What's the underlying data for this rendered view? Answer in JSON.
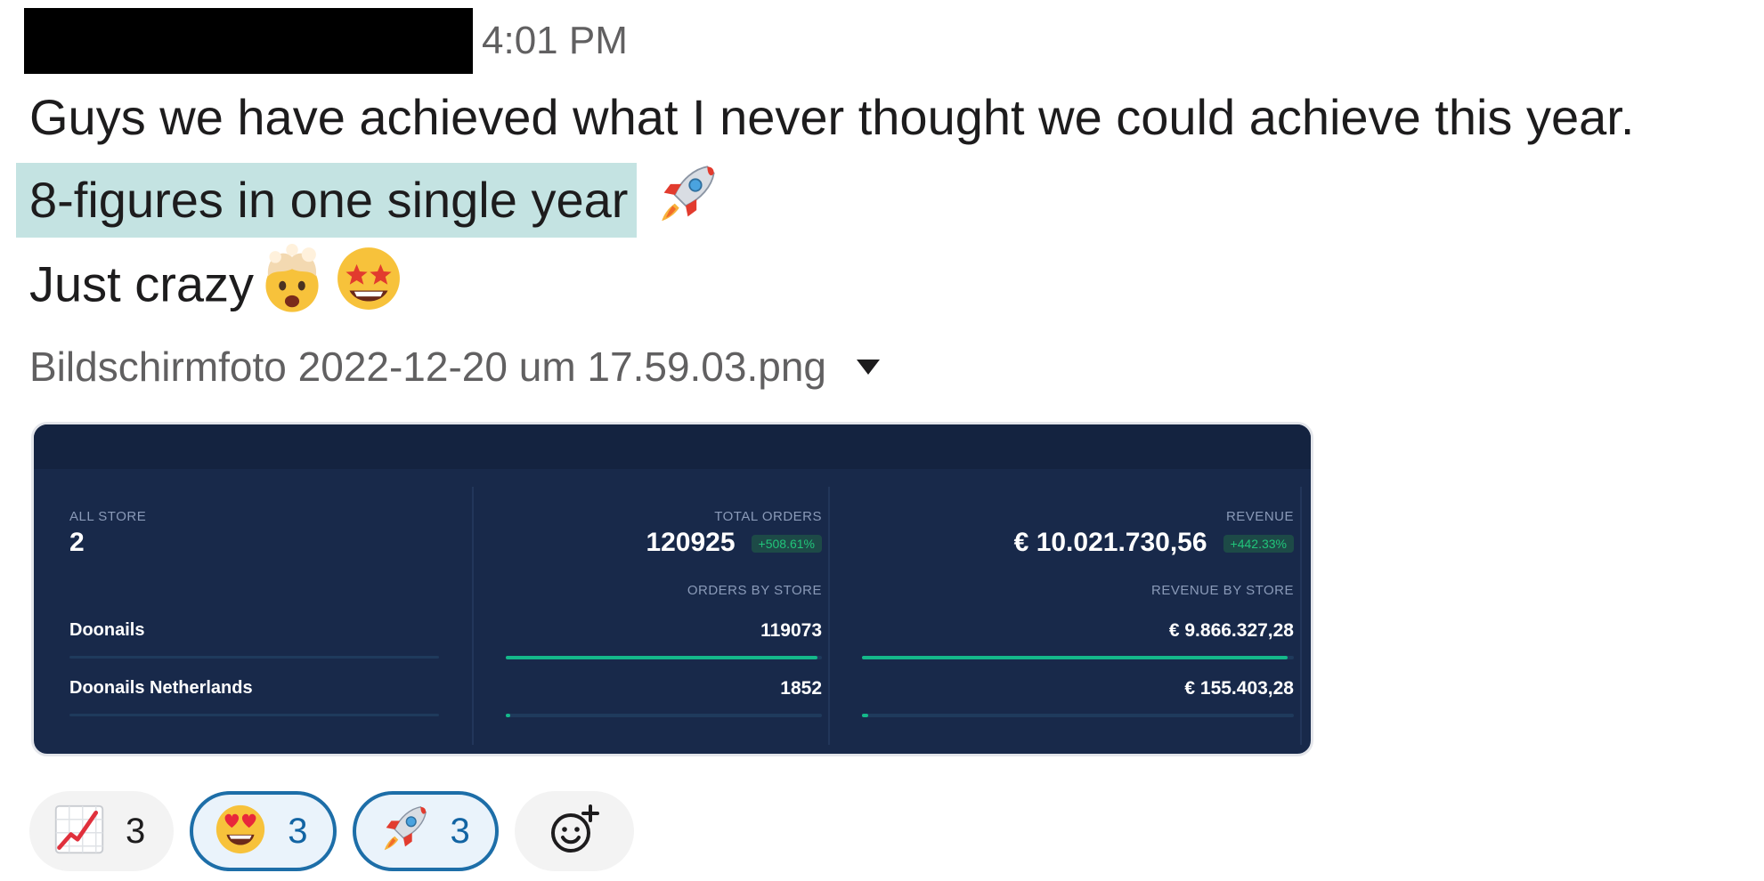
{
  "message": {
    "timestamp": "4:01 PM",
    "line1": "Guys we have achieved what I never thought we could achieve this year.",
    "line2_highlight": "8-figures in one single year",
    "line3": "Just crazy"
  },
  "attachment": {
    "file_name": "Bildschirmfoto 2022-12-20 um 17.59.03.png",
    "dashboard": {
      "all_store_label": "ALL STORE",
      "all_store_value": "2",
      "total_orders_label": "TOTAL ORDERS",
      "total_orders_value": "120925",
      "total_orders_change": "+508.61%",
      "revenue_label": "REVENUE",
      "revenue_value": "€ 10.021.730,56",
      "revenue_change": "+442.33%",
      "orders_by_store_label": "ORDERS BY STORE",
      "revenue_by_store_label": "REVENUE BY STORE",
      "stores": [
        {
          "name": "Doonails",
          "orders": "119073",
          "revenue": "€ 9.866.327,28",
          "share": 0.985
        },
        {
          "name": "Doonails Netherlands",
          "orders": "1852",
          "revenue": "€ 155.403,28",
          "share": 0.015
        }
      ]
    }
  },
  "reactions": [
    {
      "icon": "chart-increasing-icon",
      "count": "3",
      "active": false
    },
    {
      "icon": "heart-eyes-icon",
      "count": "3",
      "active": true
    },
    {
      "icon": "rocket-icon",
      "count": "3",
      "active": true
    }
  ],
  "add_reaction_icon": "add-reaction-icon",
  "colors": {
    "highlight": "#c4e3e2",
    "dashboard_bg": "#18294a",
    "bar_fill": "#14b88a",
    "reaction_active_border": "#1d6ea8"
  }
}
